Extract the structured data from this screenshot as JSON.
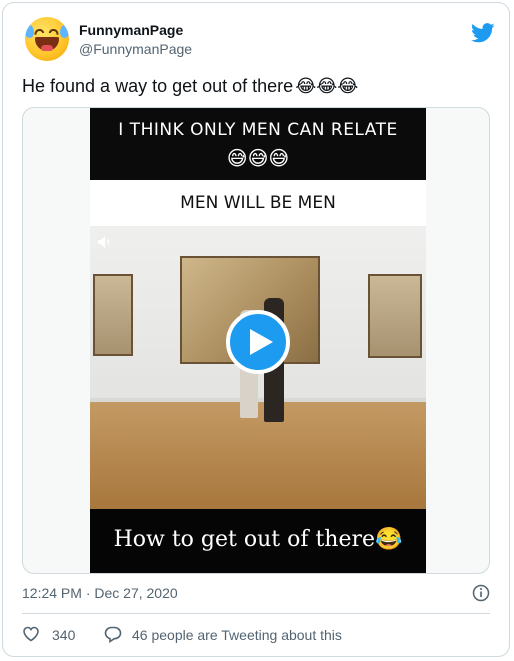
{
  "author": {
    "display_name": "FunnymanPage",
    "handle": "@FunnymanPage"
  },
  "tweet": {
    "text": "He found a way to get out of there",
    "emojis": "😂😂😂"
  },
  "media": {
    "banner_text": "I THINK ONLY MEN CAN RELATE",
    "banner_emojis": "😅😅😅",
    "title": "MEN WILL BE MEN",
    "caption": "How to get out of there",
    "caption_emoji": "😂"
  },
  "footer": {
    "timestamp": "12:24 PM · Dec 27, 2020",
    "like_count": "340",
    "reply_text": "46 people are Tweeting about this"
  },
  "colors": {
    "brand": "#1d9bf0",
    "secondary_text": "#536471",
    "border": "#cfd9de"
  },
  "icons": [
    "avatar-laughing-emoji",
    "twitter-bird-icon",
    "speaker-icon",
    "play-icon",
    "info-icon",
    "heart-icon",
    "reply-bubble-icon"
  ]
}
